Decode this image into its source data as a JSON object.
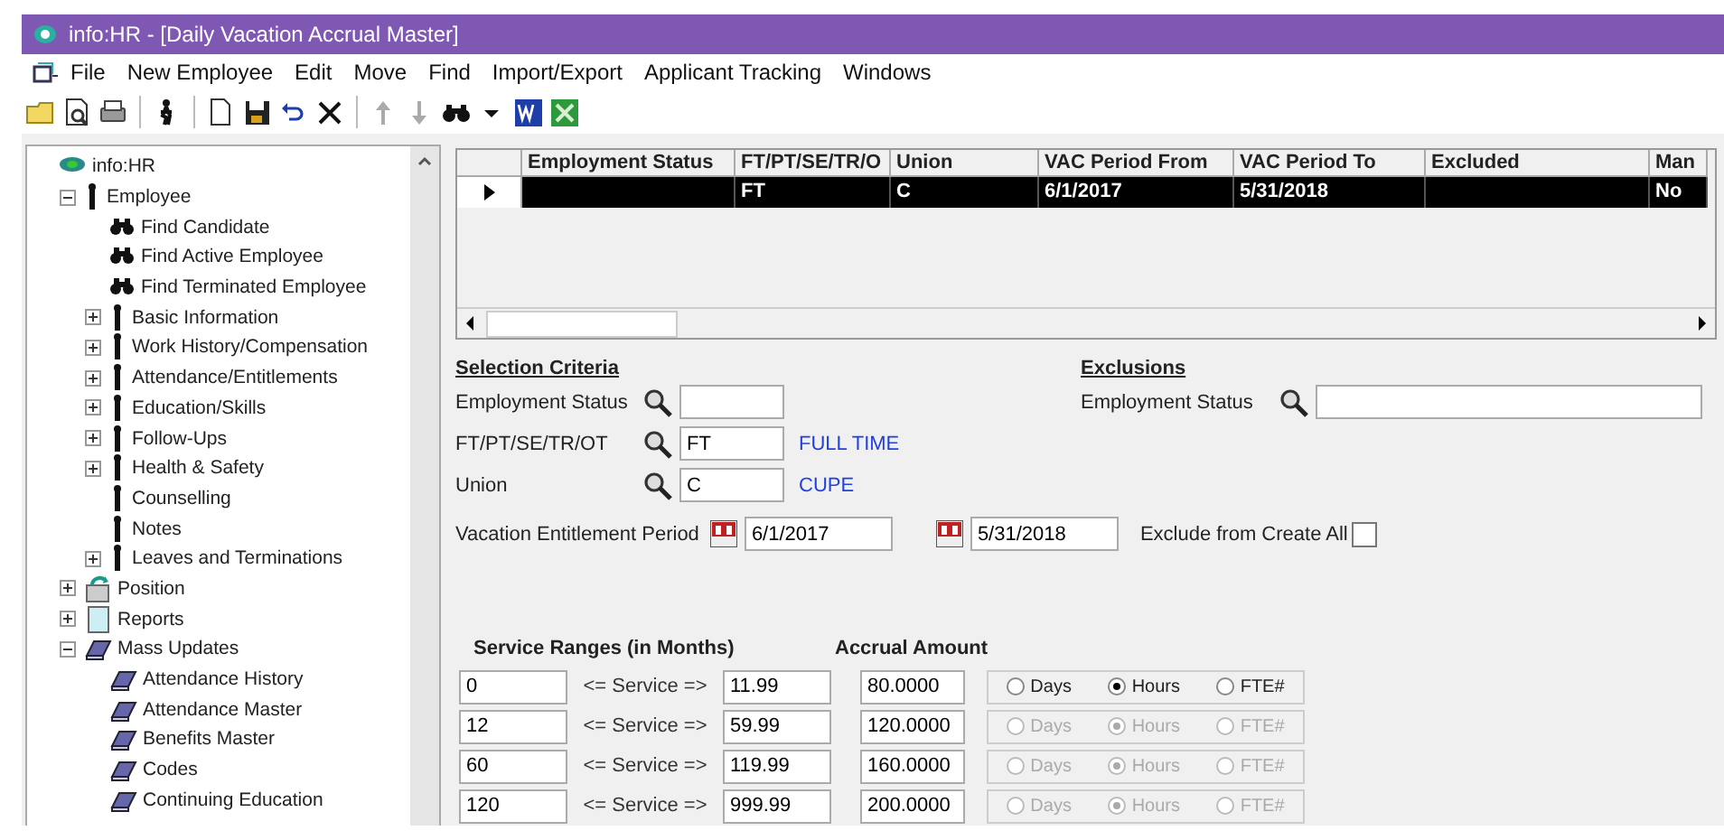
{
  "window": {
    "title": "info:HR - [Daily Vacation Accrual Master]"
  },
  "menu": [
    "File",
    "New Employee",
    "Edit",
    "Move",
    "Find",
    "Import/Export",
    "Applicant Tracking",
    "Windows"
  ],
  "toolbar": [
    {
      "kind": "folder"
    },
    {
      "kind": "preview"
    },
    {
      "kind": "print"
    },
    {
      "kind": "sep"
    },
    {
      "kind": "person"
    },
    {
      "kind": "sep"
    },
    {
      "kind": "new"
    },
    {
      "kind": "save"
    },
    {
      "kind": "undo"
    },
    {
      "kind": "delete"
    },
    {
      "kind": "sep"
    },
    {
      "kind": "up"
    },
    {
      "kind": "down"
    },
    {
      "kind": "find"
    },
    {
      "kind": "caret"
    },
    {
      "kind": "word"
    },
    {
      "kind": "excel"
    }
  ],
  "tree": [
    {
      "label": "info:HR",
      "kind": "root",
      "children": [
        {
          "label": "Employee",
          "kind": "person",
          "expanded": true,
          "children": [
            {
              "label": "Find Candidate",
              "kind": "binoculars"
            },
            {
              "label": "Find Active Employee",
              "kind": "binoculars"
            },
            {
              "label": "Find Terminated Employee",
              "kind": "binoculars"
            },
            {
              "label": "Basic Information",
              "kind": "person",
              "expanded": false
            },
            {
              "label": "Work History/Compensation",
              "kind": "person",
              "expanded": false
            },
            {
              "label": "Attendance/Entitlements",
              "kind": "person",
              "expanded": false
            },
            {
              "label": "Education/Skills",
              "kind": "person",
              "expanded": false
            },
            {
              "label": "Follow-Ups",
              "kind": "person",
              "expanded": false
            },
            {
              "label": "Health & Safety",
              "kind": "person",
              "expanded": false
            },
            {
              "label": "Counselling",
              "kind": "person"
            },
            {
              "label": "Notes",
              "kind": "person"
            },
            {
              "label": "Leaves and Terminations",
              "kind": "person",
              "expanded": false
            }
          ]
        },
        {
          "label": "Position",
          "kind": "position",
          "expanded": false
        },
        {
          "label": "Reports",
          "kind": "report",
          "expanded": false
        },
        {
          "label": "Mass Updates",
          "kind": "book",
          "expanded": true,
          "children": [
            {
              "label": "Attendance History",
              "kind": "book"
            },
            {
              "label": "Attendance Master",
              "kind": "book"
            },
            {
              "label": "Benefits Master",
              "kind": "book"
            },
            {
              "label": "Codes",
              "kind": "book"
            },
            {
              "label": "Continuing Education",
              "kind": "book"
            }
          ]
        }
      ]
    }
  ],
  "grid": {
    "columns": [
      "Employment Status",
      "FT/PT/SE/TR/O",
      "Union",
      "VAC Period From",
      "VAC Period To",
      "Excluded",
      "Man"
    ],
    "rows": [
      {
        "selected": true,
        "cells": [
          null,
          "FT",
          "C",
          "6/1/2017",
          "5/31/2018",
          null,
          "No"
        ]
      }
    ]
  },
  "selection_criteria": {
    "title": "Selection Criteria",
    "fields": [
      {
        "label": "Employment Status"
      },
      {
        "label": "FT/PT/SE/TR/OT",
        "value": "FT",
        "description": "FULL TIME"
      },
      {
        "label": "Union",
        "value": "C",
        "description": "CUPE"
      }
    ]
  },
  "exclusions": {
    "title": "Exclusions",
    "fields": [
      {
        "label": "Employment Status"
      }
    ]
  },
  "vacation_period": {
    "label": "Vacation Entitlement Period",
    "from": "6/1/2017",
    "to": "5/31/2018",
    "exclude_label": "Exclude from Create All",
    "exclude_checked": false
  },
  "service_ranges": {
    "title": "Service Ranges (in Months)",
    "amount_title": "Accrual Amount",
    "rows": [
      {
        "from": "0",
        "operator": "<= Service =>",
        "to": "11.99",
        "amount": "80.0000",
        "disabled": false,
        "units": [
          {
            "label": "Days",
            "selected": false
          },
          {
            "label": "Hours",
            "selected": true
          },
          {
            "label": "FTE#",
            "selected": false
          }
        ]
      },
      {
        "from": "12",
        "operator": "<= Service =>",
        "to": "59.99",
        "amount": "120.0000",
        "disabled": true,
        "units": [
          {
            "label": "Days",
            "selected": false
          },
          {
            "label": "Hours",
            "selected": true
          },
          {
            "label": "FTE#",
            "selected": false
          }
        ]
      },
      {
        "from": "60",
        "operator": "<= Service =>",
        "to": "119.99",
        "amount": "160.0000",
        "disabled": true,
        "units": [
          {
            "label": "Days",
            "selected": false
          },
          {
            "label": "Hours",
            "selected": true
          },
          {
            "label": "FTE#",
            "selected": false
          }
        ]
      },
      {
        "from": "120",
        "operator": "<= Service =>",
        "to": "999.99",
        "amount": "200.0000",
        "disabled": true,
        "units": [
          {
            "label": "Days",
            "selected": false
          },
          {
            "label": "Hours",
            "selected": true
          },
          {
            "label": "FTE#",
            "selected": false
          }
        ]
      }
    ]
  }
}
